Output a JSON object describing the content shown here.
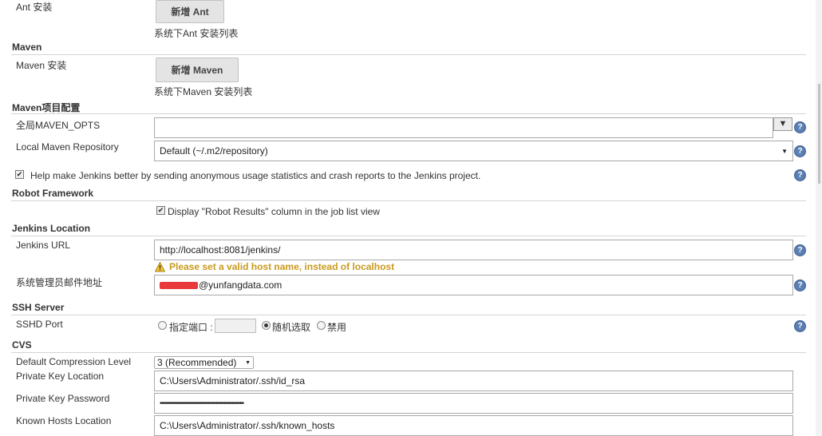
{
  "ant": {
    "label": "Ant 安装",
    "add_button": "新增 Ant",
    "caption": "系统下Ant 安装列表"
  },
  "maven": {
    "section_title": "Maven",
    "label": "Maven 安装",
    "add_button": "新增 Maven",
    "caption": "系统下Maven 安装列表"
  },
  "maven_project": {
    "section_title": "Maven项目配置",
    "opts_label": "全局MAVEN_OPTS",
    "opts_value": "",
    "expand_glyph": "▼",
    "repo_label": "Local Maven Repository",
    "repo_selected": "Default (~/.m2/repository)"
  },
  "usage_stats": {
    "checked": true,
    "text": "Help make Jenkins better by sending anonymous usage statistics and crash reports to the Jenkins project."
  },
  "robot": {
    "section_title": "Robot Framework",
    "checked": true,
    "option_text": "Display \"Robot Results\" column in the job list view"
  },
  "location": {
    "section_title": "Jenkins Location",
    "url_label": "Jenkins URL",
    "url_value": "http://localhost:8081/jenkins/",
    "warning": "Please set a valid host name, instead of localhost",
    "email_label": "系统管理员邮件地址",
    "email_value": "@yunfangdata.com"
  },
  "ssh": {
    "section_title": "SSH Server",
    "port_label": "SSHD Port",
    "fixed_label": "指定端口 :",
    "random_label": "随机选取",
    "disable_label": "禁用",
    "selected": "random"
  },
  "cvs": {
    "section_title": "CVS",
    "compression_label": "Default Compression Level",
    "compression_selected": "3 (Recommended)",
    "key_location_label": "Private Key Location",
    "key_location_value": "C:\\Users\\Administrator/.ssh/id_rsa",
    "key_password_label": "Private Key Password",
    "key_password_value": "••••••••••••••••••••••••••••••••••••••••••",
    "known_hosts_label": "Known Hosts Location",
    "known_hosts_value": "C:\\Users\\Administrator/.ssh/known_hosts"
  },
  "icons": {
    "help": "help-icon",
    "warning": "warning-icon",
    "dropdown": "chevron-down-icon"
  },
  "colors": {
    "warning_text": "#c99a1e",
    "redaction": "#e8393b",
    "help_icon": "#5b7fb3"
  }
}
